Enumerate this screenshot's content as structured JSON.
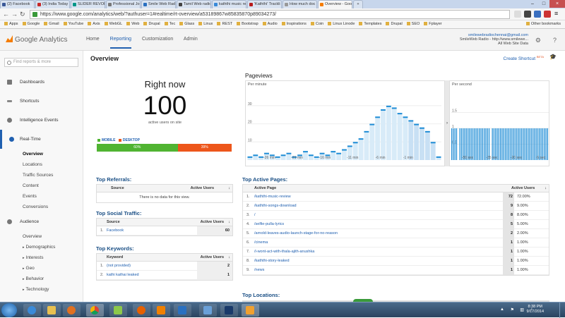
{
  "browser": {
    "tabs": [
      {
        "label": "(2) Facebook"
      },
      {
        "label": "(3) India Today"
      },
      {
        "label": "SLIDER REVOLUT"
      },
      {
        "label": "Professional Jour"
      },
      {
        "label": "Smile Web Radio"
      },
      {
        "label": "Tamil Web radio"
      },
      {
        "label": "kaththi music re"
      },
      {
        "label": "'Kaththi' Trackli"
      },
      {
        "label": "How much doc"
      },
      {
        "label": "Overview - Goog"
      }
    ],
    "url": "https://www.google.com/analytics/web/?authuser=1#realtime/rt-overview/a53189867w85835870p89034273/",
    "bookmarks": [
      "Apps",
      "Google",
      "Gmail",
      "YouTube",
      "Axis",
      "WebGL",
      "Web",
      "Drupal",
      "Tec",
      "Glass",
      "Linux",
      "REST",
      "Bootstrap",
      "Audio",
      "Inspirations",
      "Coin",
      "Linux Linode",
      "Templates",
      "Drupal",
      "SEO",
      "Fplayer"
    ],
    "other_bookmarks": "Other bookmarks"
  },
  "ga": {
    "logo": "Google Analytics",
    "nav": [
      "Home",
      "Reporting",
      "Customization",
      "Admin"
    ],
    "account_email": "smilewebradiochennai@gmail.com",
    "account_line2": "SmileWeb Radio - http://www.smilewe...",
    "account_line3": "All Web Site Data"
  },
  "sidebar": {
    "find_placeholder": "Find reports & more",
    "sections": [
      "Dashboards",
      "Shortcuts",
      "Intelligence Events",
      "Real-Time"
    ],
    "realtime_items": [
      "Overview",
      "Locations",
      "Traffic Sources",
      "Content",
      "Events",
      "Conversions"
    ],
    "audience": "Audience",
    "audience_items": [
      "Overview",
      "Demographics",
      "Interests",
      "Geo",
      "Behavior",
      "Technology"
    ]
  },
  "overview": {
    "title": "Overview",
    "create_shortcut": "Create Shortcut",
    "beta": "BETA",
    "right_now_label": "Right now",
    "active_users": "100",
    "active_users_caption": "active users on site",
    "legend_mobile": "MOBILE",
    "legend_desktop": "DESKTOP",
    "mobile_pct": "60%",
    "desktop_pct": "39%",
    "mobile_share": 0.6,
    "colors": {
      "mobile": "#50b432",
      "desktop": "#ed561b",
      "bars": "#1f8dd6"
    }
  },
  "pageviews": {
    "title": "Pageviews",
    "per_minute": "Per minute",
    "per_second": "Per second",
    "minute_yticks": [
      "30",
      "20",
      "10"
    ],
    "minute_xticks": [
      "-26 min",
      "-21 min",
      "-16 min",
      "-11 min",
      "-6 min",
      "-1 min"
    ],
    "second_yticks": [
      "1.5",
      "1",
      "0.5"
    ],
    "second_xticks": [
      "-50 sec",
      "-35 sec",
      "-20 sec",
      "-5 sec"
    ]
  },
  "chart_data": [
    {
      "type": "bar",
      "title": "Per minute",
      "ylim": [
        0,
        35
      ],
      "values": [
        2,
        3,
        2,
        4,
        3,
        2,
        3,
        4,
        2,
        3,
        5,
        3,
        2,
        4,
        3,
        5,
        4,
        6,
        8,
        10,
        12,
        16,
        20,
        24,
        28,
        30,
        29,
        26,
        24,
        22,
        20,
        18,
        16,
        10,
        2
      ]
    },
    {
      "type": "bar",
      "title": "Per second",
      "ylim": [
        0,
        2
      ],
      "values": [
        1,
        1,
        1,
        1,
        0,
        1,
        1,
        1,
        1,
        1,
        1,
        1,
        1,
        1,
        1,
        1,
        1,
        1,
        1,
        1,
        1,
        1,
        1,
        1,
        0,
        1,
        1,
        1,
        1,
        1,
        1,
        1,
        1,
        1,
        1,
        1,
        1,
        1,
        1,
        1,
        1,
        1,
        1,
        1,
        1,
        1,
        1,
        1,
        1,
        1,
        1,
        1,
        1,
        1,
        1,
        1,
        1,
        1,
        1,
        1
      ]
    }
  ],
  "referrals": {
    "title": "Top Referrals:",
    "col_source": "Source",
    "col_users": "Active Users",
    "empty": "There is no data for this view."
  },
  "social": {
    "title": "Top Social Traffic:",
    "col_source": "Source",
    "col_users": "Active Users",
    "rows": [
      {
        "n": "1.",
        "name": "Facebook",
        "value": "60"
      }
    ]
  },
  "keywords": {
    "title": "Top Keywords:",
    "col_keyword": "Keyword",
    "col_users": "Active Users",
    "rows": [
      {
        "n": "1.",
        "name": "(not provided)",
        "value": "2"
      },
      {
        "n": "2.",
        "name": "kathi kathai leaked",
        "value": "1"
      }
    ]
  },
  "pages": {
    "title": "Top Active Pages:",
    "col_page": "Active Page",
    "col_users": "Active Users",
    "rows": [
      {
        "n": "1.",
        "page": "/kaththi-music-review",
        "value": "72",
        "pct": "72.00%",
        "share": 0.72
      },
      {
        "n": "2.",
        "page": "/kaththi-songs-download",
        "value": "9",
        "pct": "9.00%",
        "share": 0.09
      },
      {
        "n": "3.",
        "page": "/",
        "value": "8",
        "pct": "8.00%",
        "share": 0.08
      },
      {
        "n": "4.",
        "page": "/selfie-pulla-lyrics",
        "value": "5",
        "pct": "5.00%",
        "share": 0.05
      },
      {
        "n": "5.",
        "page": "/arnold-leaves-audio-launch-stage-for-no-reason",
        "value": "2",
        "pct": "2.00%",
        "share": 0.02
      },
      {
        "n": "6.",
        "page": "/cinema",
        "value": "1",
        "pct": "1.00%",
        "share": 0.01
      },
      {
        "n": "7.",
        "page": "/i-wont-act-with-thala-ajith-anushka",
        "value": "1",
        "pct": "1.00%",
        "share": 0.01
      },
      {
        "n": "8.",
        "page": "/kaththi-story-leaked",
        "value": "1",
        "pct": "1.00%",
        "share": 0.01
      },
      {
        "n": "9.",
        "page": "/news",
        "value": "1",
        "pct": "1.00%",
        "share": 0.01
      }
    ]
  },
  "locations": {
    "title": "Top Locations:"
  },
  "taskbar": {
    "time": "8:38 PM",
    "date": "9/17/2014"
  }
}
